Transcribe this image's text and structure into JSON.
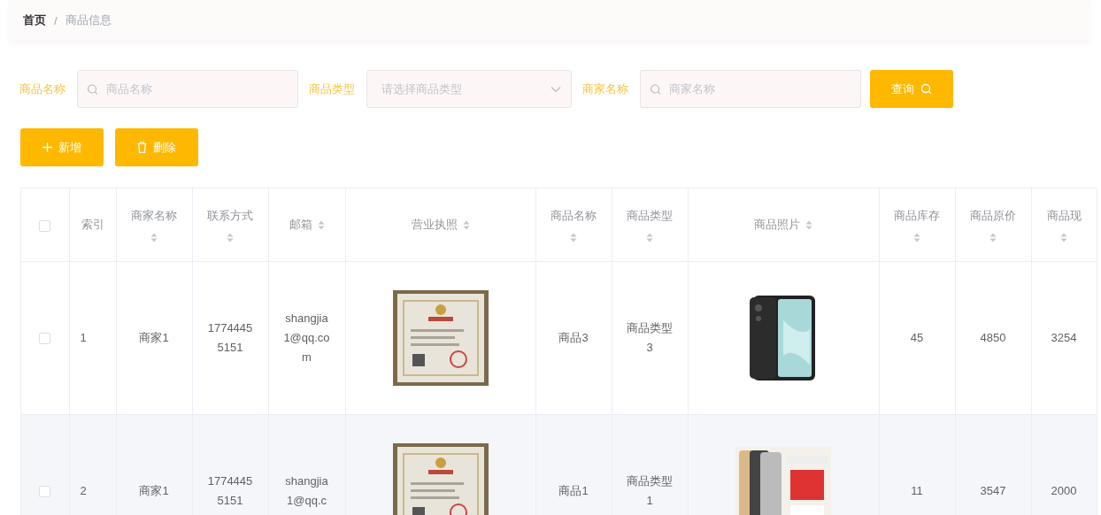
{
  "breadcrumb": [
    "首页",
    "/",
    "商品信息"
  ],
  "filters": [
    {
      "kind": "input",
      "label": "商品名称",
      "placeholder": "商品名称"
    },
    {
      "kind": "select",
      "label": "商品类型",
      "placeholder": "请选择商品类型"
    },
    {
      "kind": "input",
      "label": "商家名称",
      "placeholder": "商家名称"
    }
  ],
  "search_button": "查询",
  "actions": [
    {
      "kind": "add",
      "label": "新增"
    },
    {
      "kind": "delete",
      "label": "删除"
    }
  ],
  "table": {
    "header_checked": false,
    "columns": [
      {
        "label": "索引",
        "sortable": false
      },
      {
        "label": "商家名称",
        "sortable": true
      },
      {
        "label": "联系方式",
        "sortable": true
      },
      {
        "label": "邮箱",
        "sortable": true
      },
      {
        "label": "营业执照",
        "sortable": true
      },
      {
        "label": "商品名称",
        "sortable": true
      },
      {
        "label": "商品类型",
        "sortable": true
      },
      {
        "label": "商品照片",
        "sortable": true
      },
      {
        "label": "商品库存",
        "sortable": true
      },
      {
        "label": "商品原价",
        "sortable": true
      },
      {
        "label": "商品现",
        "sortable": true
      }
    ],
    "rows": [
      {
        "checked": false,
        "cells": [
          {
            "kind": "text",
            "text": "1"
          },
          {
            "kind": "text",
            "text": "商家1"
          },
          {
            "kind": "text",
            "text": "17744455151"
          },
          {
            "kind": "text",
            "text": "shangjia1@qq.com"
          },
          {
            "kind": "picture"
          },
          {
            "kind": "text",
            "text": "商品3"
          },
          {
            "kind": "text",
            "text": "商品类型3"
          },
          {
            "kind": "picture"
          },
          {
            "kind": "text",
            "text": "45"
          },
          {
            "kind": "text",
            "text": "4850"
          },
          {
            "kind": "text",
            "text": "3254"
          }
        ]
      },
      {
        "checked": false,
        "cells": [
          {
            "kind": "text",
            "text": "2"
          },
          {
            "kind": "text",
            "text": "商家1"
          },
          {
            "kind": "text",
            "text": "17744455151"
          },
          {
            "kind": "text",
            "text": "shangjia1@qq.c"
          },
          {
            "kind": "picture"
          },
          {
            "kind": "text",
            "text": "商品1"
          },
          {
            "kind": "text",
            "text": "商品类型1"
          },
          {
            "kind": "picture"
          },
          {
            "kind": "text",
            "text": "11"
          },
          {
            "kind": "text",
            "text": "3547"
          },
          {
            "kind": "text",
            "text": "2000"
          }
        ]
      }
    ]
  }
}
